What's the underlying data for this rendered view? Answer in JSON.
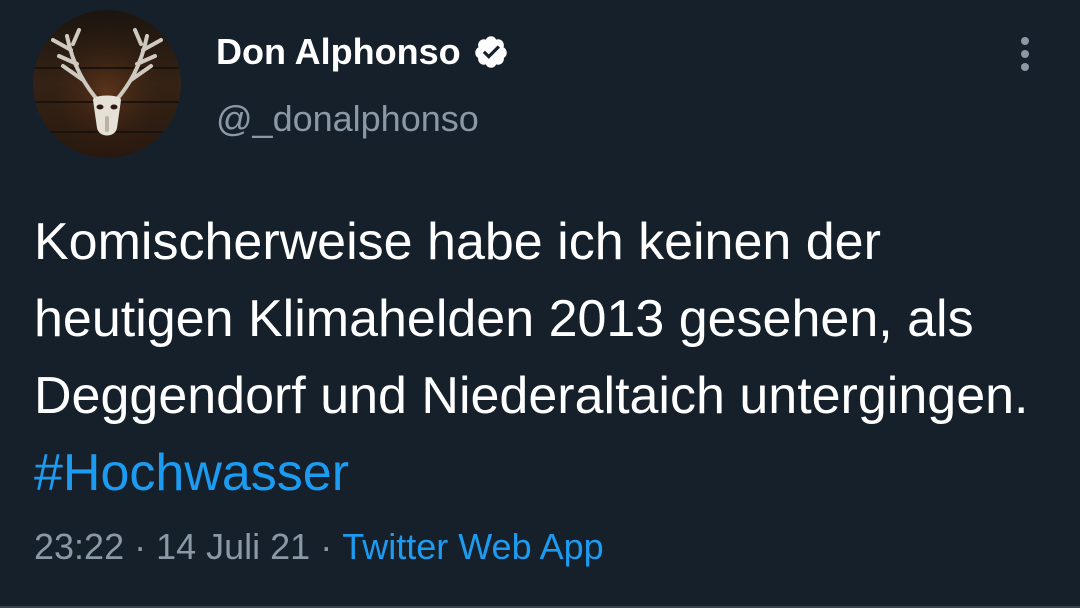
{
  "author": {
    "display_name": "Don Alphonso",
    "handle": "@_donalphonso",
    "verified": true,
    "avatar_icon": "deer-skull-antlers-icon"
  },
  "tweet": {
    "text": "Komischerweise habe ich keinen der heutigen Klimahelden 2013 gesehen, als Deggendorf und Niederaltaich untergingen.",
    "hashtag": "#Hochwasser"
  },
  "meta": {
    "time": "23:22",
    "separator": "·",
    "date": "14 Juli 21",
    "source": "Twitter Web App"
  },
  "colors": {
    "background": "#15202b",
    "text": "#ffffff",
    "secondary": "#8b98a5",
    "accent": "#1d9bf0"
  },
  "icons": {
    "more": "more-vertical-icon",
    "verified": "verified-badge-icon"
  }
}
